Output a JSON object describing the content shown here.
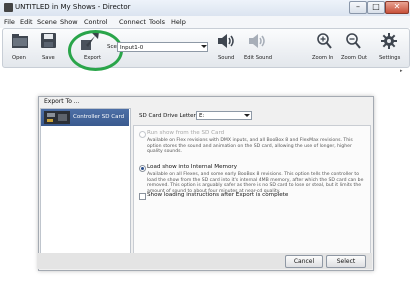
{
  "window": {
    "title": "UNTITLED in My Shows - Director",
    "controls": {
      "minimize": "–",
      "maximize": "□",
      "close": "✕"
    }
  },
  "menu": {
    "items": [
      "File",
      "Edit",
      "Scene",
      "Show",
      "Control",
      "Connect",
      "Tools",
      "Help"
    ]
  },
  "toolbar": {
    "open": "Open",
    "save": "Save",
    "export": "Export",
    "scene_label": "Scene:",
    "scene_value": "Input1-0",
    "sound": "Sound",
    "edit_sound": "Edit Sound",
    "zoom_in": "Zoom In",
    "zoom_out": "Zoom Out",
    "settings": "Settings",
    "highlight_color": "#2aa54a"
  },
  "dialog": {
    "title": "Export To ...",
    "targets": [
      {
        "label": "Controller SD Card",
        "selected": true
      }
    ],
    "drive_label": "SD Card Drive Letter:",
    "drive_value": "E:",
    "options": [
      {
        "title": "Run show from the SD Card",
        "description": "Available on Flex revisions with DMX inputs, and all BooBox 8 and FlexMax revisions. This option stores the sound and animation on the SD card, allowing the use of longer, higher quality sounds.",
        "enabled": false,
        "selected": false
      },
      {
        "title": "Load show into Internal Memory",
        "description": "Available on all Flexes, and some early BooBox 8 revisions. This option tells the controller to load the show from the SD card into it's internal 4MB memory, after which the SD card can be removed. This option is arguably safer as there is no SD card to lose or steal, but it limits the amount of sound to about four minutes at near-cd quality.",
        "enabled": true,
        "selected": true
      }
    ],
    "checkbox_label": "Show loading instructions after Export is complete",
    "checkbox_checked": false,
    "cancel": "Cancel",
    "select": "Select"
  }
}
